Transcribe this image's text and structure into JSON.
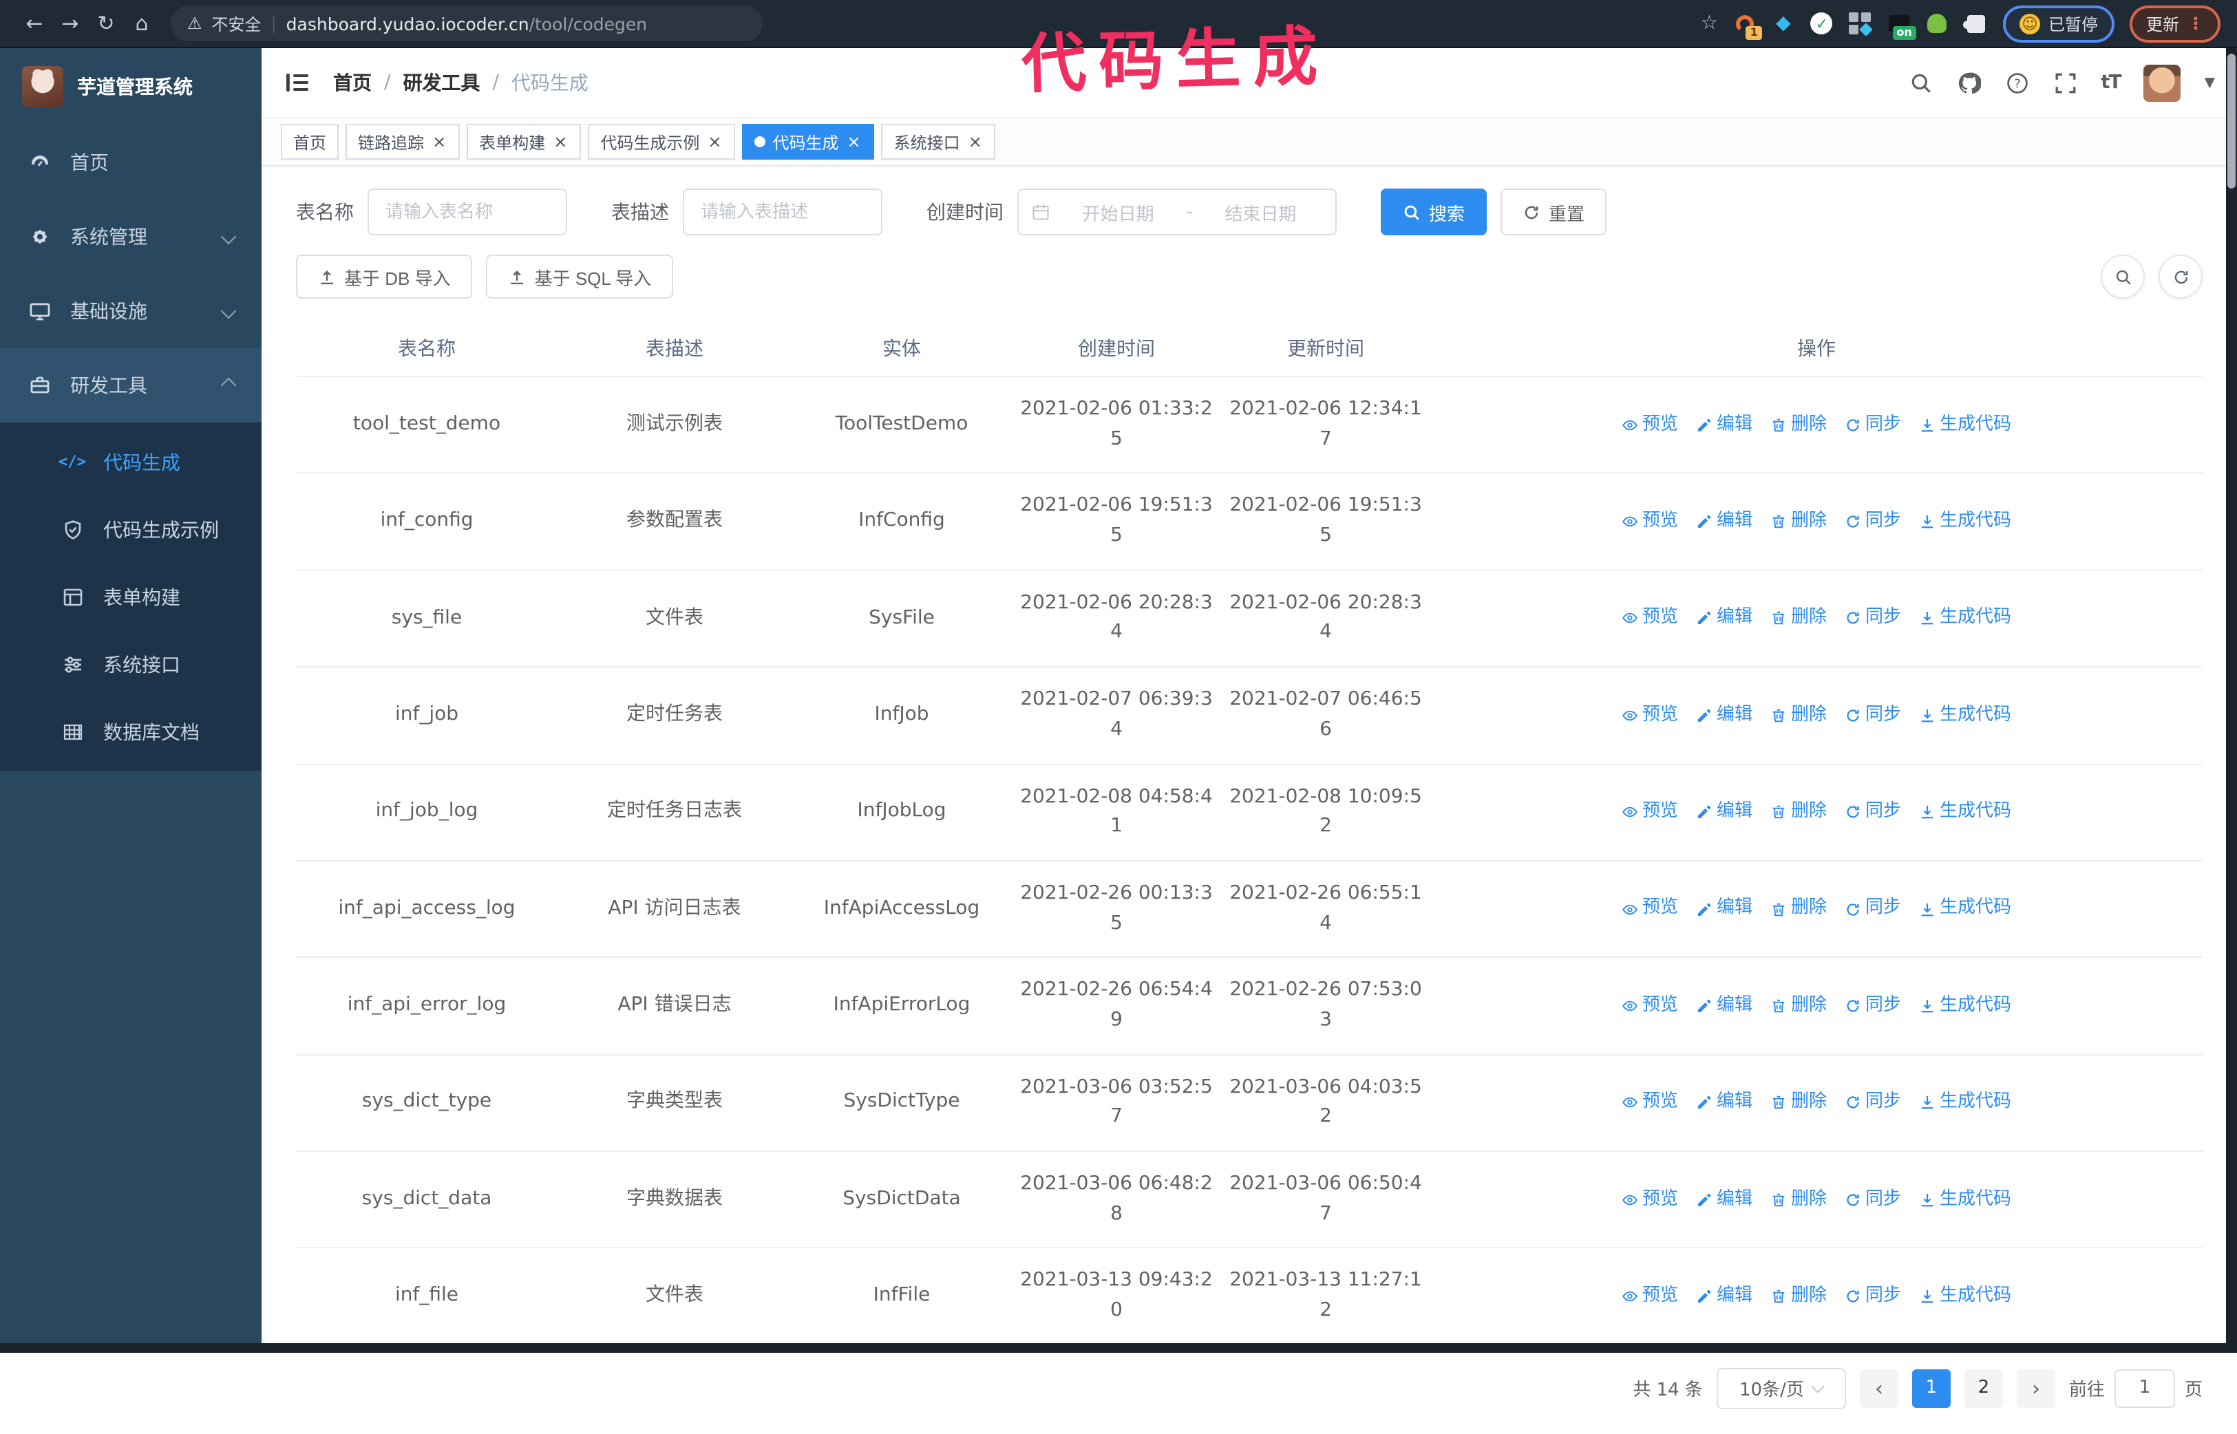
{
  "browser": {
    "security_label": "不安全",
    "url_host": "dashboard.yudao.iocoder.cn",
    "url_path": "/tool/codegen",
    "ext_badge_count": "1",
    "ext_badge_on": "on",
    "paused_badge": "已暂停",
    "update_button": "更新"
  },
  "annotation": {
    "text": "代码生成",
    "color": "#ef2f5f"
  },
  "sidebar": {
    "app_title": "芋道管理系统",
    "items": [
      {
        "name": "home",
        "label": "首页",
        "icon": "dashboard-icon",
        "expandable": false,
        "expanded": false
      },
      {
        "name": "system-mgmt",
        "label": "系统管理",
        "icon": "gear-icon",
        "expandable": true,
        "expanded": false
      },
      {
        "name": "infrastructure",
        "label": "基础设施",
        "icon": "monitor-icon",
        "expandable": true,
        "expanded": false
      },
      {
        "name": "dev-tools",
        "label": "研发工具",
        "icon": "toolbox-icon",
        "expandable": true,
        "expanded": true
      }
    ],
    "submenu": [
      {
        "name": "codegen",
        "label": "代码生成",
        "icon": "code-icon",
        "active": true
      },
      {
        "name": "codegen-demo",
        "label": "代码生成示例",
        "icon": "shield-check-icon",
        "active": false
      },
      {
        "name": "form-builder",
        "label": "表单构建",
        "icon": "form-icon",
        "active": false
      },
      {
        "name": "system-api",
        "label": "系统接口",
        "icon": "sliders-icon",
        "active": false
      },
      {
        "name": "db-docs",
        "label": "数据库文档",
        "icon": "table-grid-icon",
        "active": false
      }
    ]
  },
  "header": {
    "breadcrumb": [
      "首页",
      "研发工具",
      "代码生成"
    ],
    "breadcrumb_separator": "/"
  },
  "tabs": [
    {
      "label": "首页",
      "closable": false,
      "active": false
    },
    {
      "label": "链路追踪",
      "closable": true,
      "active": false
    },
    {
      "label": "表单构建",
      "closable": true,
      "active": false
    },
    {
      "label": "代码生成示例",
      "closable": true,
      "active": false
    },
    {
      "label": "代码生成",
      "closable": true,
      "active": true
    },
    {
      "label": "系统接口",
      "closable": true,
      "active": false
    }
  ],
  "search_form": {
    "table_name_label": "表名称",
    "table_name_placeholder": "请输入表名称",
    "table_desc_label": "表描述",
    "table_desc_placeholder": "请输入表描述",
    "create_time_label": "创建时间",
    "date_start_placeholder": "开始日期",
    "date_separator": "-",
    "date_end_placeholder": "结束日期",
    "search_button": "搜索",
    "reset_button": "重置"
  },
  "toolbar": {
    "import_db_button": "基于 DB 导入",
    "import_sql_button": "基于 SQL 导入"
  },
  "table": {
    "columns": [
      "表名称",
      "表描述",
      "实体",
      "创建时间",
      "更新时间",
      "操作"
    ],
    "row_actions": [
      "预览",
      "编辑",
      "删除",
      "同步",
      "生成代码"
    ],
    "rows": [
      {
        "name": "tool_test_demo",
        "description": "测试示例表",
        "entity": "ToolTestDemo",
        "create_time": "2021-02-06 01:33:25",
        "update_time": "2021-02-06 12:34:17"
      },
      {
        "name": "inf_config",
        "description": "参数配置表",
        "entity": "InfConfig",
        "create_time": "2021-02-06 19:51:35",
        "update_time": "2021-02-06 19:51:35"
      },
      {
        "name": "sys_file",
        "description": "文件表",
        "entity": "SysFile",
        "create_time": "2021-02-06 20:28:34",
        "update_time": "2021-02-06 20:28:34"
      },
      {
        "name": "inf_job",
        "description": "定时任务表",
        "entity": "InfJob",
        "create_time": "2021-02-07 06:39:34",
        "update_time": "2021-02-07 06:46:56"
      },
      {
        "name": "inf_job_log",
        "description": "定时任务日志表",
        "entity": "InfJobLog",
        "create_time": "2021-02-08 04:58:41",
        "update_time": "2021-02-08 10:09:52"
      },
      {
        "name": "inf_api_access_log",
        "description": "API 访问日志表",
        "entity": "InfApiAccessLog",
        "create_time": "2021-02-26 00:13:35",
        "update_time": "2021-02-26 06:55:14"
      },
      {
        "name": "inf_api_error_log",
        "description": "API 错误日志",
        "entity": "InfApiErrorLog",
        "create_time": "2021-02-26 06:54:49",
        "update_time": "2021-02-26 07:53:03"
      },
      {
        "name": "sys_dict_type",
        "description": "字典类型表",
        "entity": "SysDictType",
        "create_time": "2021-03-06 03:52:57",
        "update_time": "2021-03-06 04:03:52"
      },
      {
        "name": "sys_dict_data",
        "description": "字典数据表",
        "entity": "SysDictData",
        "create_time": "2021-03-06 06:48:28",
        "update_time": "2021-03-06 06:50:47"
      },
      {
        "name": "inf_file",
        "description": "文件表",
        "entity": "InfFile",
        "create_time": "2021-03-13 09:43:20",
        "update_time": "2021-03-13 11:27:12"
      }
    ]
  },
  "pagination": {
    "total_text": "共 14 条",
    "page_size": "10条/页",
    "pages": [
      "1",
      "2"
    ],
    "active_page": "1",
    "goto_label": "前往",
    "goto_value": "1",
    "goto_suffix": "页"
  },
  "colors": {
    "accent_blue": "#2d8cf0",
    "active_link_blue": "#3da2ff",
    "sidebar_bg": "#2a4760",
    "sidebar_submenu_bg": "#1c3349",
    "annotation_pink": "#ef2f5f",
    "chrome_bg": "#202a35"
  }
}
